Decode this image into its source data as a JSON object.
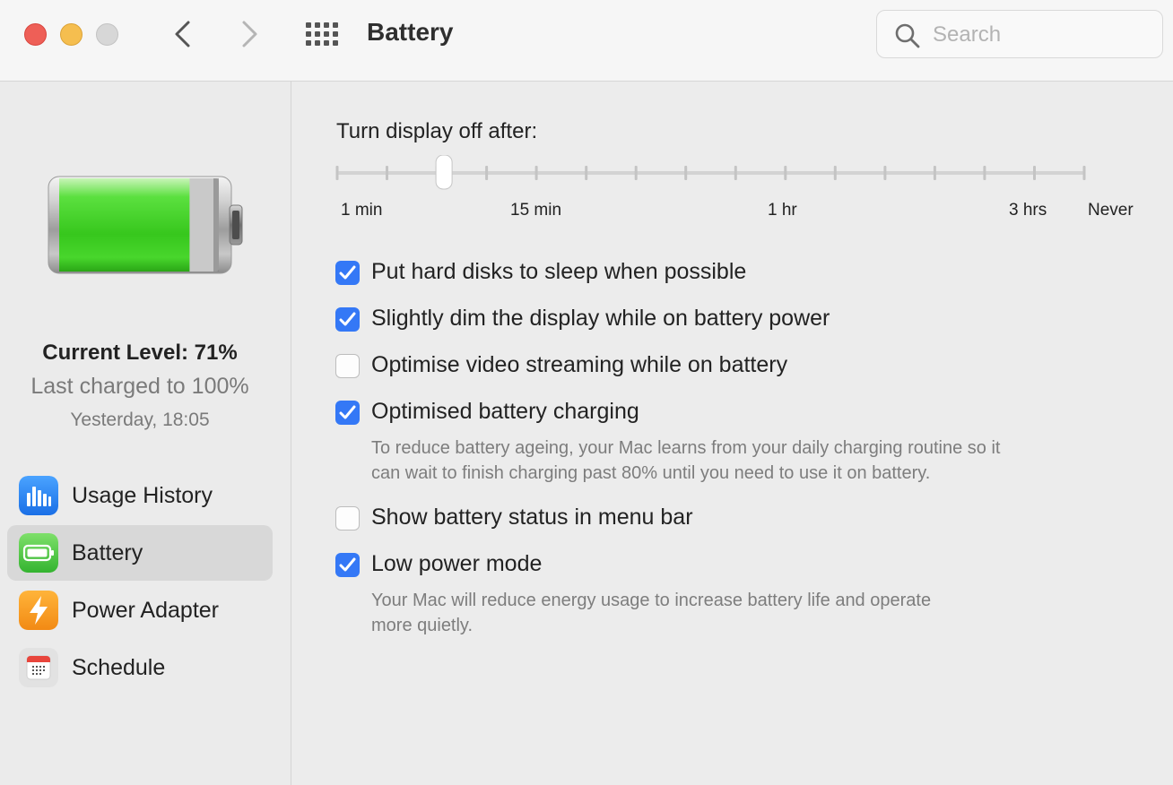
{
  "window": {
    "title": "Battery"
  },
  "toolbar": {
    "search_placeholder": "Search"
  },
  "sidebar": {
    "current_level": "Current Level: 71%",
    "last_charged": "Last charged to 100%",
    "charged_time": "Yesterday, 18:05",
    "battery_fill_fraction": 0.71,
    "items": [
      {
        "label": "Usage History",
        "icon": "usage-history-icon",
        "selected": false
      },
      {
        "label": "Battery",
        "icon": "battery-icon",
        "selected": true
      },
      {
        "label": "Power Adapter",
        "icon": "power-adapter-icon",
        "selected": false
      },
      {
        "label": "Schedule",
        "icon": "schedule-icon",
        "selected": false
      }
    ]
  },
  "display_off": {
    "label": "Turn display off after:",
    "tick_labels": [
      "1 min",
      "15 min",
      "1 hr",
      "3 hrs",
      "Never"
    ],
    "tick_count": 16,
    "selected_tick_index": 2
  },
  "options": [
    {
      "label": "Put hard disks to sleep when possible",
      "checked": true
    },
    {
      "label": "Slightly dim the display while on battery power",
      "checked": true
    },
    {
      "label": "Optimise video streaming while on battery",
      "checked": false
    },
    {
      "label": "Optimised battery charging",
      "checked": true,
      "description": [
        "To reduce battery ageing, your Mac learns from your daily charging routine so it",
        "can wait to finish charging past 80% until you need to use it on battery."
      ]
    },
    {
      "label": "Show battery status in menu bar",
      "checked": false
    },
    {
      "label": "Low power mode",
      "checked": true,
      "description": [
        "Your Mac will reduce energy usage to increase battery life and operate",
        "more quietly."
      ]
    }
  ],
  "colors": {
    "accent": "#3478f6",
    "battery_green": "#3fcf2c",
    "close": "#ee5f57",
    "minimize": "#f5be4f"
  }
}
